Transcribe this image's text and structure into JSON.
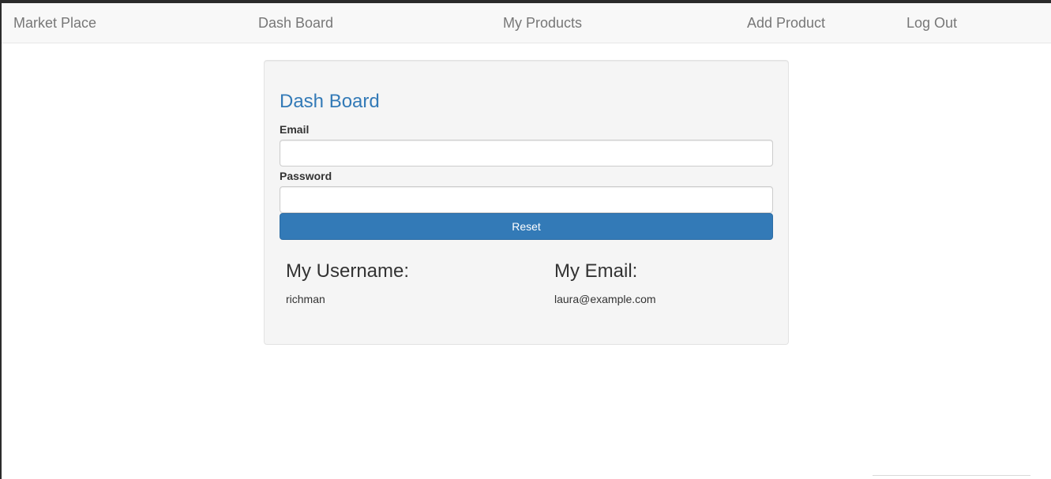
{
  "navbar": {
    "brand": "Market Place",
    "links": [
      "Dash Board",
      "My Products",
      "Add Product",
      "Log Out"
    ]
  },
  "panel": {
    "title": "Dash Board",
    "email_label": "Email",
    "email_value": "",
    "password_label": "Password",
    "password_value": "",
    "reset_label": "Reset",
    "username_heading": "My Username:",
    "username_value": "richman",
    "email_heading": "My Email:",
    "email_display": "laura@example.com"
  },
  "colors": {
    "accent": "#337ab7",
    "navbar_bg": "#f8f8f8",
    "panel_bg": "#f5f5f5",
    "nav_text": "#777777"
  }
}
